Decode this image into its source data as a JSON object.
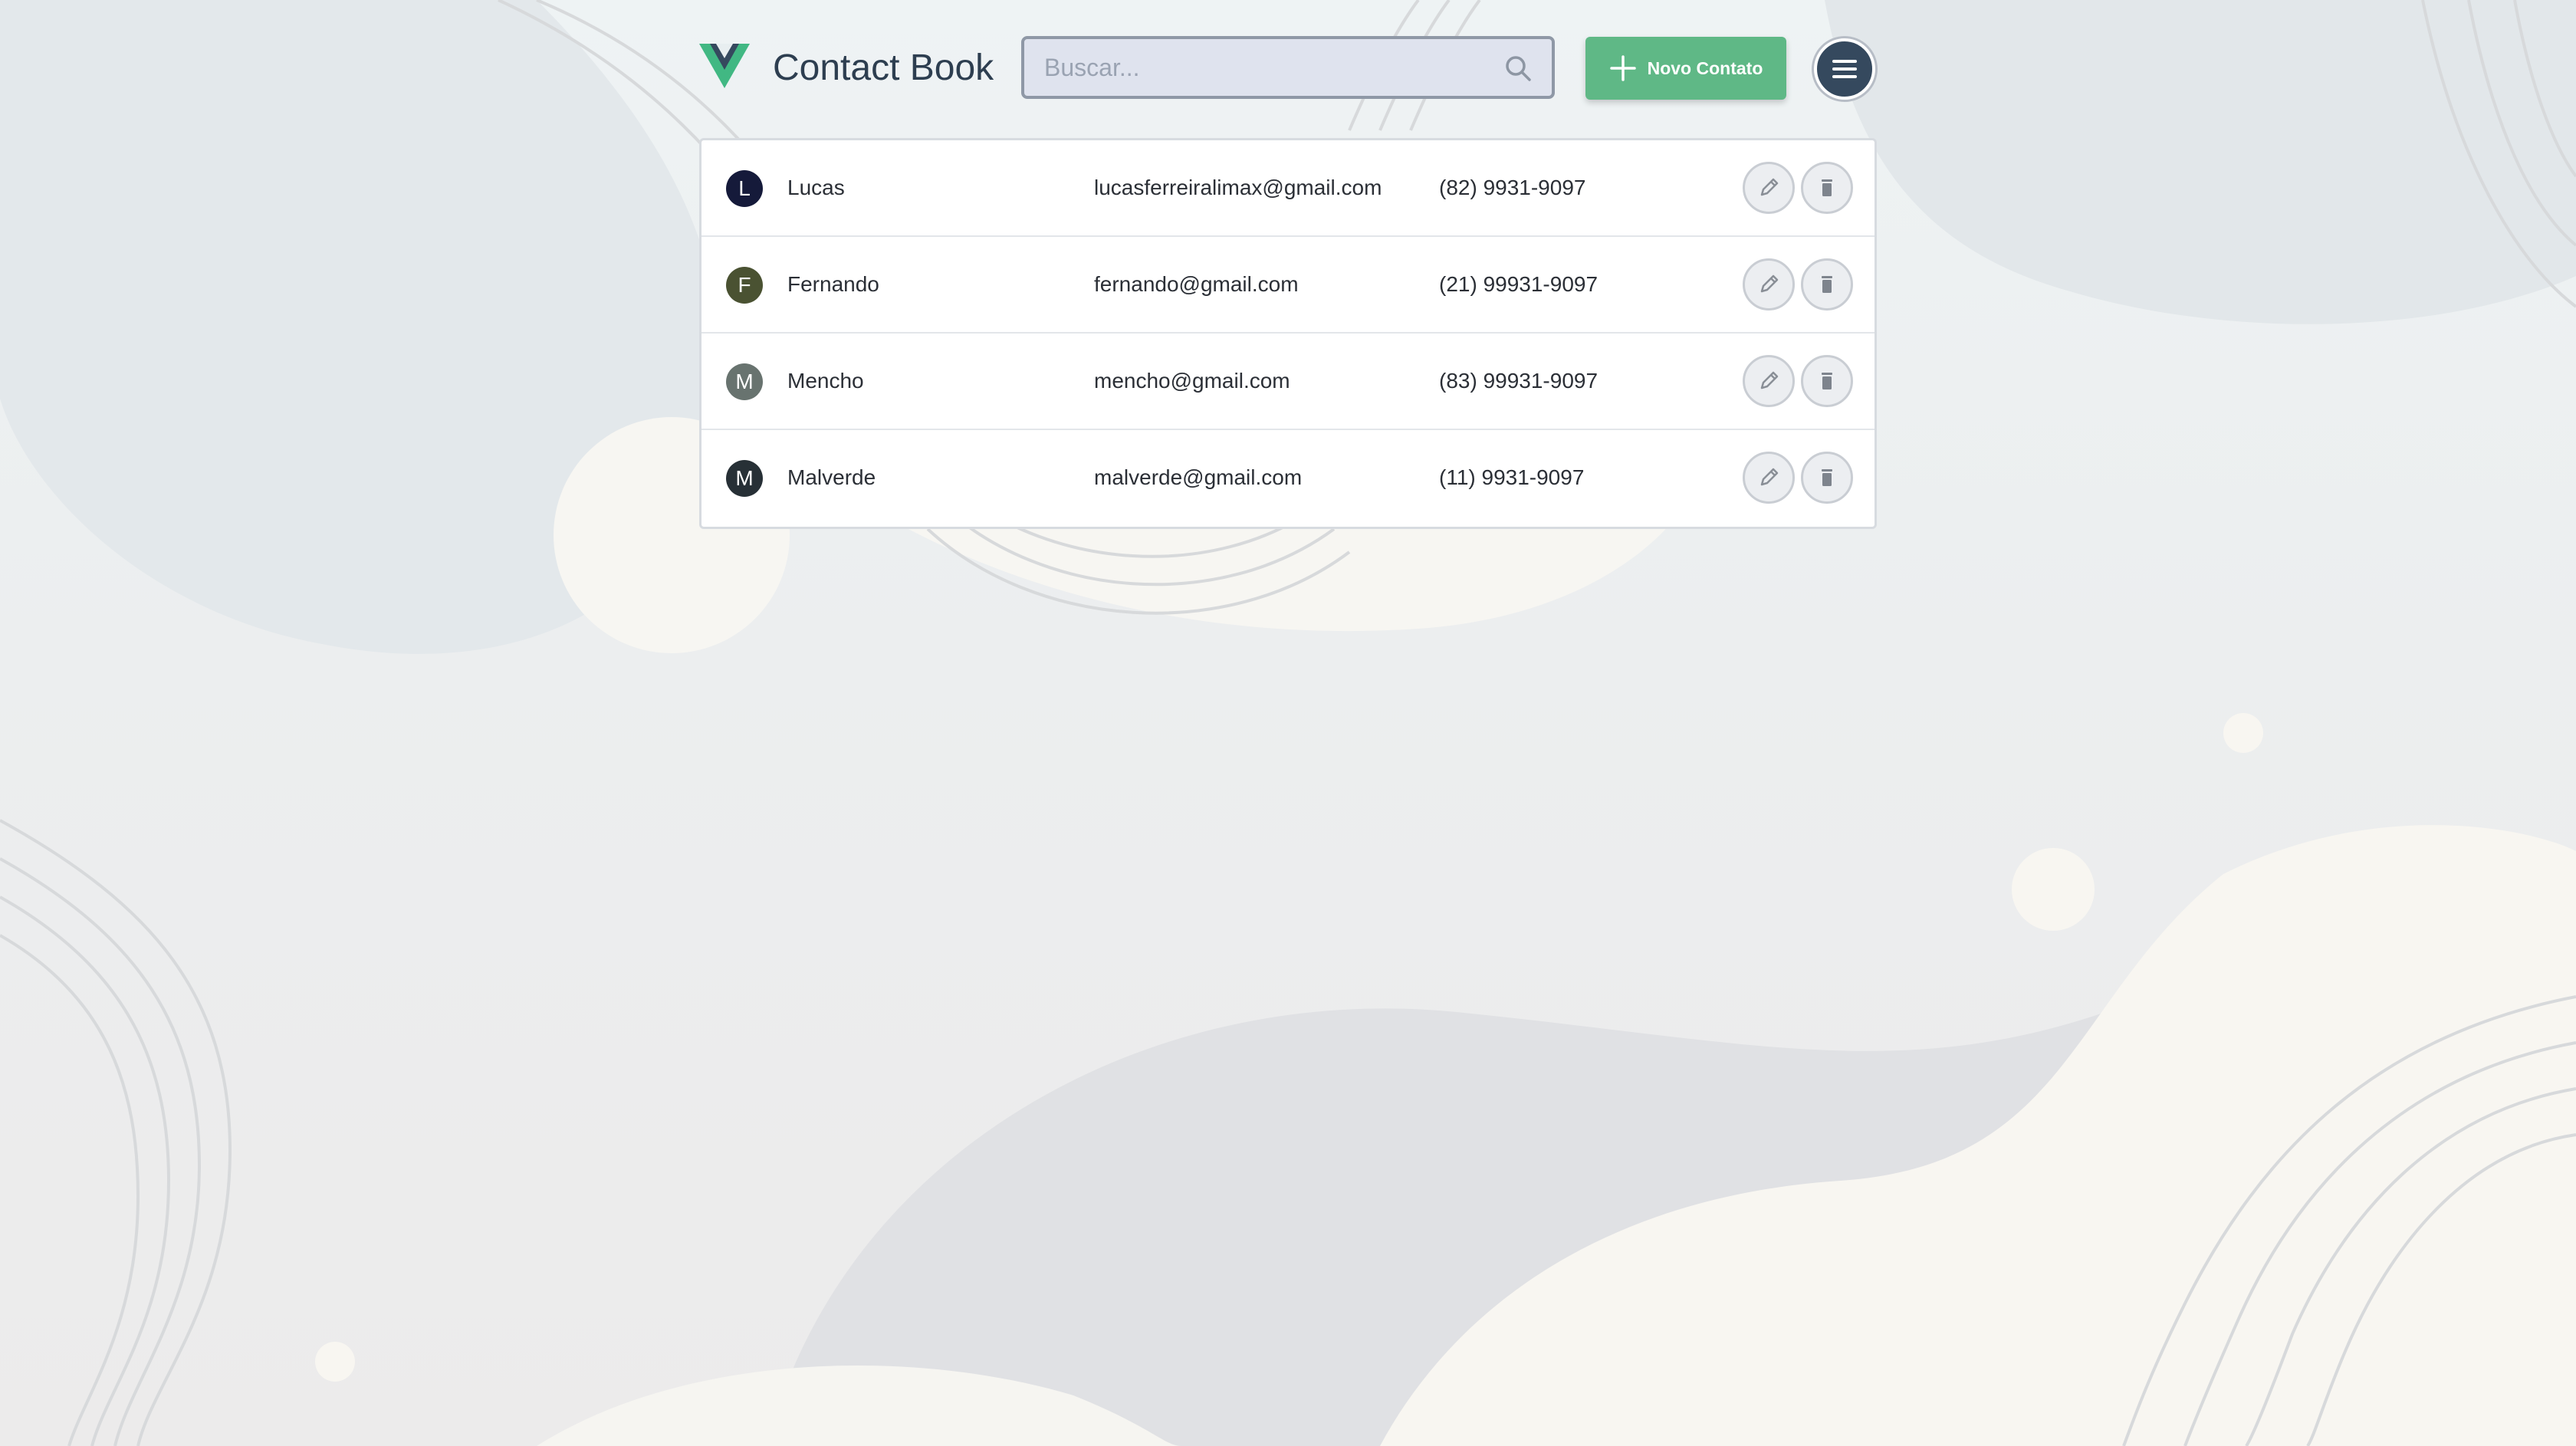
{
  "app": {
    "title": "Contact Book",
    "logo": "vue-logo"
  },
  "search": {
    "placeholder": "Buscar...",
    "value": "",
    "icon": "search-icon"
  },
  "actions": {
    "new_contact_label": "Novo Contato",
    "new_contact_icon": "plus-icon",
    "menu_icon": "hamburger-menu-icon"
  },
  "contacts": [
    {
      "initial": "L",
      "name": "Lucas",
      "email": "lucasferreiralimax@gmail.com",
      "phone": "(82) 9931-9097",
      "avatar_color": "#151a3a"
    },
    {
      "initial": "F",
      "name": "Fernando",
      "email": "fernando@gmail.com",
      "phone": "(21) 99931-9097",
      "avatar_color": "#4a5232"
    },
    {
      "initial": "M",
      "name": "Mencho",
      "email": "mencho@gmail.com",
      "phone": "(83) 99931-9097",
      "avatar_color": "#68736f"
    },
    {
      "initial": "M",
      "name": "Malverde",
      "email": "malverde@gmail.com",
      "phone": "(11) 9931-9097",
      "avatar_color": "#273036"
    }
  ],
  "colors": {
    "accent": "#5fb886",
    "brand_dark": "#35495e",
    "vue_green": "#41b883"
  }
}
